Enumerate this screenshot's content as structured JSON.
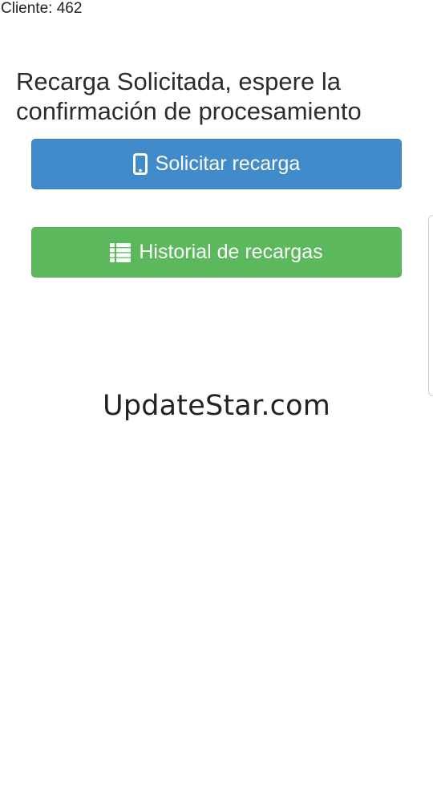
{
  "client": {
    "label": "Cliente: 462"
  },
  "page": {
    "title": "Recarga Solicitada, espere la confirmación de procesamiento"
  },
  "buttons": {
    "request": {
      "label": "Solicitar recarga",
      "icon": "mobile-phone-icon",
      "color": "#428bca"
    },
    "history": {
      "label": "Historial de recargas",
      "icon": "list-icon",
      "color": "#5cb85c"
    }
  },
  "watermark": {
    "text": "UpdateStar.com"
  }
}
